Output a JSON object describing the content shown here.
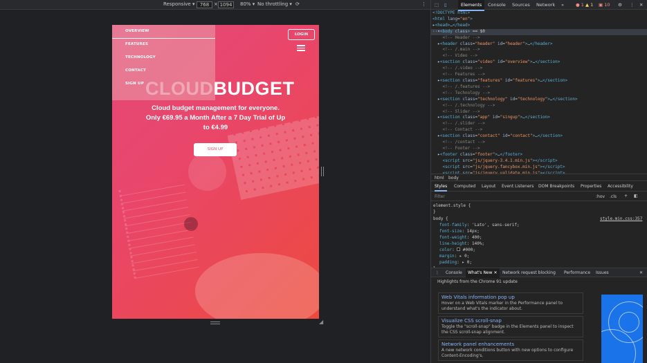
{
  "device_toolbar": {
    "mode": "Responsive",
    "width": "768",
    "height": "1094",
    "zoom": "80%",
    "throttling": "No throttling",
    "times": "×"
  },
  "site": {
    "menu": [
      "OVERVIEW",
      "FEATURES",
      "TECHNOLOGY",
      "CONTACT",
      "SIGN UP"
    ],
    "login": "LOGIN",
    "title_faded": "CLOUD",
    "title_main": "BUDGET",
    "tagline": "Cloud budget management for everyone. Only €69.95 a Month After a 7 Day Trial of Up to €4.99",
    "signup": "SIGN UP"
  },
  "devtools": {
    "tabs": [
      "Elements",
      "Console",
      "Sources",
      "Network",
      "»"
    ],
    "badges": {
      "errors": "1",
      "warnings": "1",
      "messages": "10"
    },
    "breadcrumbs": [
      "html",
      "body"
    ],
    "style_tabs": [
      "Styles",
      "Computed",
      "Layout",
      "Event Listeners",
      "DOM Breakpoints",
      "Properties",
      "Accessibility"
    ],
    "filter_placeholder": "Filter",
    "filter_tools": [
      ":hov",
      ".cls",
      "+"
    ],
    "styles": {
      "element_style": "element.style {",
      "element_close": "}",
      "body_rule": "body {",
      "source": "style.min.css:357",
      "props": [
        {
          "k": "font-family",
          "v": "'Lato', sans-serif;"
        },
        {
          "k": "font-size",
          "v": "14px;"
        },
        {
          "k": "font-weight",
          "v": "400;"
        },
        {
          "k": "line-height",
          "v": "140%;"
        },
        {
          "k": "color",
          "v": "#000;"
        },
        {
          "k": "margin",
          "v": "0;"
        },
        {
          "k": "padding",
          "v": "0;"
        }
      ],
      "body_close": "}"
    },
    "drawer_tabs": [
      "Console",
      "What's New",
      "Network request blocking",
      "Performance",
      "Issues"
    ],
    "whats_new": {
      "heading": "Highlights from the Chrome 91 update",
      "cards": [
        {
          "title": "Web Vitals information pop up",
          "body": "Hover on a Web Vitals marker in the Performance panel to understand what's the indicator about."
        },
        {
          "title": "Visualize CSS scroll-snap",
          "body": "Toggle the \"scroll-snap\" badge in the Elements panel to inspect the CSS scroll-snap alignment."
        },
        {
          "title": "Network panel enhancements",
          "body": "A new network conditions button with new options to configure Content-Encoding's."
        }
      ]
    }
  }
}
